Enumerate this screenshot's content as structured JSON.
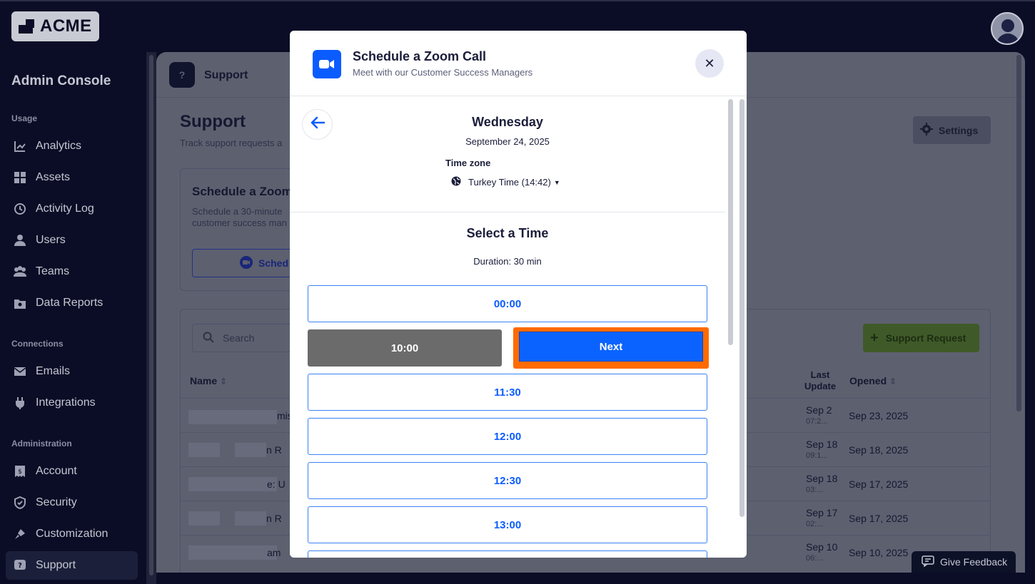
{
  "brand": {
    "logo_text": "ACME"
  },
  "sidebar": {
    "title": "Admin Console",
    "sections": [
      {
        "label": "Usage",
        "items": [
          {
            "label": "Analytics",
            "icon": "chart-icon"
          },
          {
            "label": "Assets",
            "icon": "grid-icon"
          },
          {
            "label": "Activity Log",
            "icon": "history-icon"
          },
          {
            "label": "Users",
            "icon": "user-icon"
          },
          {
            "label": "Teams",
            "icon": "team-icon"
          },
          {
            "label": "Data Reports",
            "icon": "report-icon"
          }
        ]
      },
      {
        "label": "Connections",
        "items": [
          {
            "label": "Emails",
            "icon": "mail-icon"
          },
          {
            "label": "Integrations",
            "icon": "plug-icon"
          }
        ]
      },
      {
        "label": "Administration",
        "items": [
          {
            "label": "Account",
            "icon": "invoice-icon"
          },
          {
            "label": "Security",
            "icon": "shield-icon"
          },
          {
            "label": "Customization",
            "icon": "brush-icon"
          },
          {
            "label": "Support",
            "icon": "support-icon",
            "active": true
          }
        ]
      }
    ]
  },
  "main": {
    "header_label": "Support",
    "page_title": "Support",
    "page_subtitle": "Track support requests a",
    "settings_label": "Settings",
    "zoom_card": {
      "title": "Schedule a Zoom",
      "text_line1": "Schedule a 30-minute",
      "text_line2": "customer success man",
      "button_label": "Sched"
    },
    "search_placeholder": "Search",
    "support_request_label": "Support Request",
    "columns": {
      "name": "Name",
      "last_update_1": "Last",
      "last_update_2": "Update",
      "opened": "Opened"
    },
    "rows": [
      {
        "name_fragment": "mis",
        "last_update": "Sep 2",
        "last_update_time": "07:2...",
        "opened": "Sep 23, 2025"
      },
      {
        "name_fragment": "n R",
        "last_update": "Sep 18",
        "last_update_time": "09:1...",
        "opened": "Sep 18, 2025"
      },
      {
        "name_fragment": "e: U",
        "last_update": "Sep 18",
        "last_update_time": "03:...",
        "opened": "Sep 17, 2025"
      },
      {
        "name_fragment": "n R",
        "last_update": "Sep 17",
        "last_update_time": "02:...",
        "opened": "Sep 17, 2025"
      },
      {
        "name_fragment": "am",
        "last_update": "Sep 10",
        "last_update_time": "06:...",
        "opened": "Sep 10, 2025"
      }
    ]
  },
  "feedback_label": "Give Feedback",
  "modal": {
    "title": "Schedule a Zoom Call",
    "subtitle": "Meet with our Customer Success Managers",
    "day": "Wednesday",
    "date": "September 24, 2025",
    "timezone_label": "Time zone",
    "timezone_value": "Turkey Time (14:42)",
    "select_title": "Select a Time",
    "duration": "Duration: 30 min",
    "slots": [
      "00:00",
      "11:30",
      "12:00",
      "12:30",
      "13:00"
    ],
    "selected_slot": "10:00",
    "next_label": "Next"
  },
  "colors": {
    "accent": "#0b63ff",
    "highlight": "#ff6b00",
    "selected_slot": "#6b6b6b",
    "zoom_blue": "#0b5cff"
  }
}
